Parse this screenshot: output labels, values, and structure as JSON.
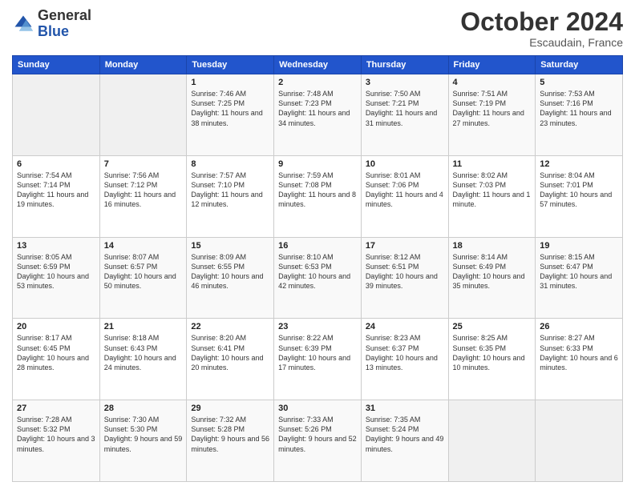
{
  "header": {
    "logo_line1": "General",
    "logo_line2": "Blue",
    "month": "October 2024",
    "location": "Escaudain, France"
  },
  "days_of_week": [
    "Sunday",
    "Monday",
    "Tuesday",
    "Wednesday",
    "Thursday",
    "Friday",
    "Saturday"
  ],
  "weeks": [
    [
      {
        "day": "",
        "detail": ""
      },
      {
        "day": "",
        "detail": ""
      },
      {
        "day": "1",
        "detail": "Sunrise: 7:46 AM\nSunset: 7:25 PM\nDaylight: 11 hours and 38 minutes."
      },
      {
        "day": "2",
        "detail": "Sunrise: 7:48 AM\nSunset: 7:23 PM\nDaylight: 11 hours and 34 minutes."
      },
      {
        "day": "3",
        "detail": "Sunrise: 7:50 AM\nSunset: 7:21 PM\nDaylight: 11 hours and 31 minutes."
      },
      {
        "day": "4",
        "detail": "Sunrise: 7:51 AM\nSunset: 7:19 PM\nDaylight: 11 hours and 27 minutes."
      },
      {
        "day": "5",
        "detail": "Sunrise: 7:53 AM\nSunset: 7:16 PM\nDaylight: 11 hours and 23 minutes."
      }
    ],
    [
      {
        "day": "6",
        "detail": "Sunrise: 7:54 AM\nSunset: 7:14 PM\nDaylight: 11 hours and 19 minutes."
      },
      {
        "day": "7",
        "detail": "Sunrise: 7:56 AM\nSunset: 7:12 PM\nDaylight: 11 hours and 16 minutes."
      },
      {
        "day": "8",
        "detail": "Sunrise: 7:57 AM\nSunset: 7:10 PM\nDaylight: 11 hours and 12 minutes."
      },
      {
        "day": "9",
        "detail": "Sunrise: 7:59 AM\nSunset: 7:08 PM\nDaylight: 11 hours and 8 minutes."
      },
      {
        "day": "10",
        "detail": "Sunrise: 8:01 AM\nSunset: 7:06 PM\nDaylight: 11 hours and 4 minutes."
      },
      {
        "day": "11",
        "detail": "Sunrise: 8:02 AM\nSunset: 7:03 PM\nDaylight: 11 hours and 1 minute."
      },
      {
        "day": "12",
        "detail": "Sunrise: 8:04 AM\nSunset: 7:01 PM\nDaylight: 10 hours and 57 minutes."
      }
    ],
    [
      {
        "day": "13",
        "detail": "Sunrise: 8:05 AM\nSunset: 6:59 PM\nDaylight: 10 hours and 53 minutes."
      },
      {
        "day": "14",
        "detail": "Sunrise: 8:07 AM\nSunset: 6:57 PM\nDaylight: 10 hours and 50 minutes."
      },
      {
        "day": "15",
        "detail": "Sunrise: 8:09 AM\nSunset: 6:55 PM\nDaylight: 10 hours and 46 minutes."
      },
      {
        "day": "16",
        "detail": "Sunrise: 8:10 AM\nSunset: 6:53 PM\nDaylight: 10 hours and 42 minutes."
      },
      {
        "day": "17",
        "detail": "Sunrise: 8:12 AM\nSunset: 6:51 PM\nDaylight: 10 hours and 39 minutes."
      },
      {
        "day": "18",
        "detail": "Sunrise: 8:14 AM\nSunset: 6:49 PM\nDaylight: 10 hours and 35 minutes."
      },
      {
        "day": "19",
        "detail": "Sunrise: 8:15 AM\nSunset: 6:47 PM\nDaylight: 10 hours and 31 minutes."
      }
    ],
    [
      {
        "day": "20",
        "detail": "Sunrise: 8:17 AM\nSunset: 6:45 PM\nDaylight: 10 hours and 28 minutes."
      },
      {
        "day": "21",
        "detail": "Sunrise: 8:18 AM\nSunset: 6:43 PM\nDaylight: 10 hours and 24 minutes."
      },
      {
        "day": "22",
        "detail": "Sunrise: 8:20 AM\nSunset: 6:41 PM\nDaylight: 10 hours and 20 minutes."
      },
      {
        "day": "23",
        "detail": "Sunrise: 8:22 AM\nSunset: 6:39 PM\nDaylight: 10 hours and 17 minutes."
      },
      {
        "day": "24",
        "detail": "Sunrise: 8:23 AM\nSunset: 6:37 PM\nDaylight: 10 hours and 13 minutes."
      },
      {
        "day": "25",
        "detail": "Sunrise: 8:25 AM\nSunset: 6:35 PM\nDaylight: 10 hours and 10 minutes."
      },
      {
        "day": "26",
        "detail": "Sunrise: 8:27 AM\nSunset: 6:33 PM\nDaylight: 10 hours and 6 minutes."
      }
    ],
    [
      {
        "day": "27",
        "detail": "Sunrise: 7:28 AM\nSunset: 5:32 PM\nDaylight: 10 hours and 3 minutes."
      },
      {
        "day": "28",
        "detail": "Sunrise: 7:30 AM\nSunset: 5:30 PM\nDaylight: 9 hours and 59 minutes."
      },
      {
        "day": "29",
        "detail": "Sunrise: 7:32 AM\nSunset: 5:28 PM\nDaylight: 9 hours and 56 minutes."
      },
      {
        "day": "30",
        "detail": "Sunrise: 7:33 AM\nSunset: 5:26 PM\nDaylight: 9 hours and 52 minutes."
      },
      {
        "day": "31",
        "detail": "Sunrise: 7:35 AM\nSunset: 5:24 PM\nDaylight: 9 hours and 49 minutes."
      },
      {
        "day": "",
        "detail": ""
      },
      {
        "day": "",
        "detail": ""
      }
    ]
  ]
}
